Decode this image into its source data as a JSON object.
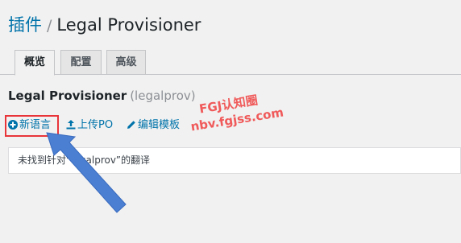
{
  "breadcrumb": {
    "parent": "插件",
    "separator": "/",
    "current": "Legal Provisioner"
  },
  "tabs": [
    {
      "label": "概览",
      "active": true
    },
    {
      "label": "配置",
      "active": false
    },
    {
      "label": "高级",
      "active": false
    }
  ],
  "project": {
    "name": "Legal Provisioner",
    "slug": "(legalprov)"
  },
  "actions": {
    "new_language": "新语言",
    "upload_po": "上传PO",
    "edit_template": "编辑模板"
  },
  "notice": {
    "text": "未找到针对“legalprov”的翻译"
  },
  "watermark": {
    "line1": "FGJ认知圈",
    "line2": "nbv.fgjss.com"
  },
  "colors": {
    "link": "#0073aa",
    "highlight": "#e8353a",
    "arrow": "#4a7fd1",
    "watermark": "#f05a5a"
  }
}
